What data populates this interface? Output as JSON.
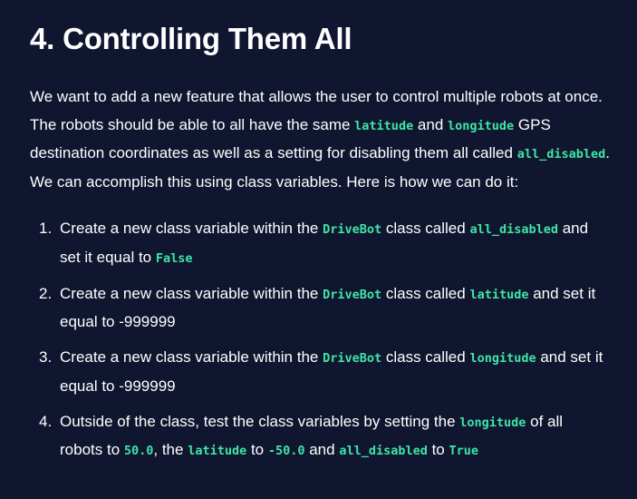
{
  "heading": "4. Controlling Them All",
  "intro": {
    "t1": "We want to add a new feature that allows the user to control multiple robots at once. The robots should be able to all have the same ",
    "c1": "latitude",
    "t2": " and ",
    "c2": "longitude",
    "t3": " GPS destination coordinates as well as a setting for disabling them all called ",
    "c3": "all_disabled",
    "t4": ". We can accomplish this using class variables. Here is how we can do it:"
  },
  "steps": [
    {
      "num": "1.",
      "t1": "Create a new class variable within the ",
      "c1": "DriveBot",
      "t2": " class called ",
      "c2": "all_disabled",
      "t3": " and set it equal to ",
      "c3": "False"
    },
    {
      "num": "2.",
      "t1": "Create a new class variable within the ",
      "c1": "DriveBot",
      "t2": " class called ",
      "c2": "latitude",
      "t3": " and set it equal to -999999"
    },
    {
      "num": "3.",
      "t1": "Create a new class variable within the ",
      "c1": "DriveBot",
      "t2": " class called ",
      "c2": "longitude",
      "t3": " and set it equal to -999999"
    },
    {
      "num": "4.",
      "t1": "Outside of the class, test the class variables by setting the ",
      "c1": "longitude",
      "t2": " of all robots to ",
      "c2": "50.0",
      "t3": ", the ",
      "c3": "latitude",
      "t4": " to ",
      "c4": "-50.0",
      "t5": " and ",
      "c5": "all_disabled",
      "t6": " to ",
      "c6": "True"
    }
  ],
  "colors": {
    "background": "#10162f",
    "text": "#ffffff",
    "code": "#3ee6a6"
  }
}
